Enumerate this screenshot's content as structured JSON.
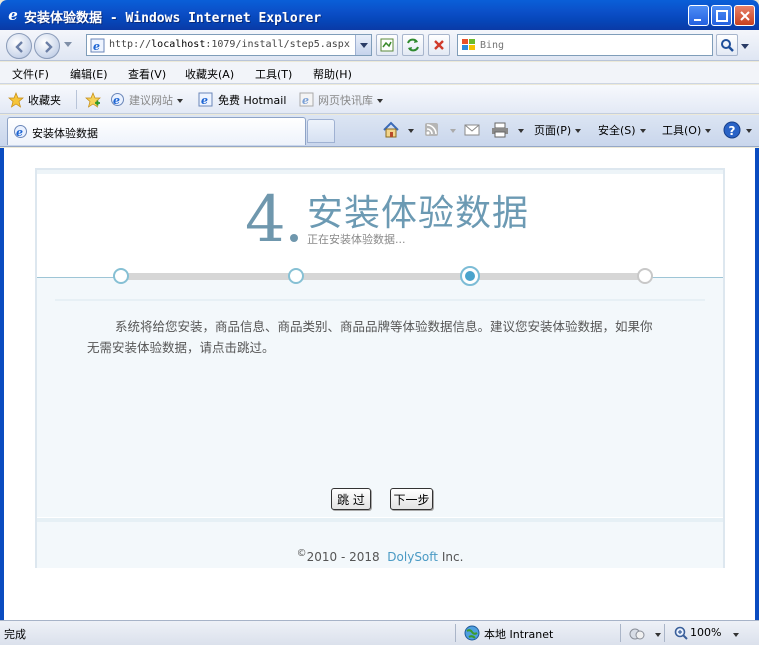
{
  "window": {
    "title": "安装体验数据 - Windows Internet Explorer"
  },
  "address": {
    "url_prefix": "http://",
    "url_host": "localhost",
    "url_rest": ":1079/install/step5.aspx"
  },
  "search": {
    "placeholder": "Bing"
  },
  "menu": {
    "file": "文件(F)",
    "edit": "编辑(E)",
    "view": "查看(V)",
    "favorites": "收藏夹(A)",
    "tools": "工具(T)",
    "help": "帮助(H)"
  },
  "favbar": {
    "favorites": "收藏夹",
    "suggested": "建议网站",
    "hotmail": "免费 Hotmail",
    "webslice": "网页快讯库"
  },
  "tab": {
    "label": "安装体验数据"
  },
  "commandbar": {
    "page": "页面(P)",
    "safety": "安全(S)",
    "tools": "工具(O)"
  },
  "content": {
    "step_number": "4",
    "step_title": "安装体验数据",
    "step_subtitle": "正在安装体验数据...",
    "steps_total": 4,
    "steps_current": 3,
    "description": "系统将给您安装，商品信息、商品类别、商品品牌等体验数据信息。建议您安装体验数据，如果你无需安装体验数据，请点击跳过。",
    "skip_label": "跳 过",
    "next_label": "下一步",
    "copyright_symbol": "©",
    "copyright_years": "2010 - 2018",
    "copyright_brand": "DolySoft",
    "copyright_suffix": "Inc."
  },
  "status": {
    "text": "完成",
    "zone": "本地 Intranet",
    "zoom": "100%"
  },
  "colors": {
    "accent": "#6c9ab3",
    "link": "#4a9ac4",
    "step_done": "#86c0d4",
    "step_active": "#4aa3cc",
    "step_pending": "#c8c8c8"
  }
}
